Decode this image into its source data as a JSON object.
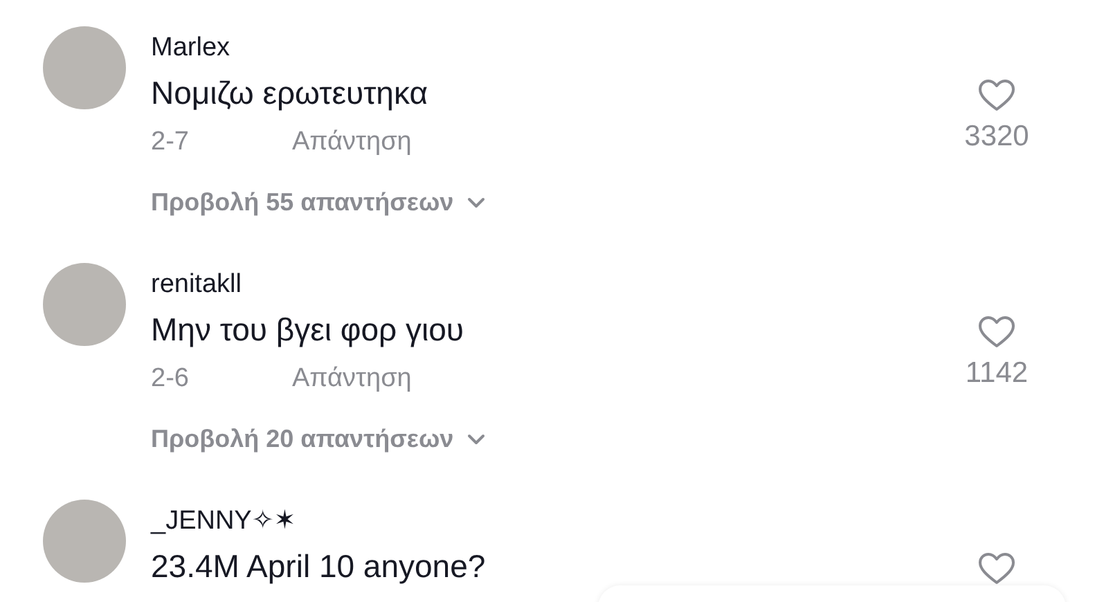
{
  "comments": [
    {
      "username": "Marlex",
      "text": "Νομιζω ερωτευτηκα",
      "date": "2-7",
      "reply_label": "Απάντηση",
      "likes": "3320",
      "view_replies": "Προβολή 55 απαντήσεων"
    },
    {
      "username": "renitakll",
      "text": "Μην του βγει φορ γιου",
      "date": "2-6",
      "reply_label": "Απάντηση",
      "likes": "1142",
      "view_replies": "Προβολή 20 απαντήσεων"
    },
    {
      "username": "_JENNY✧✶",
      "text": "23.4M April 10 anyone?"
    }
  ]
}
